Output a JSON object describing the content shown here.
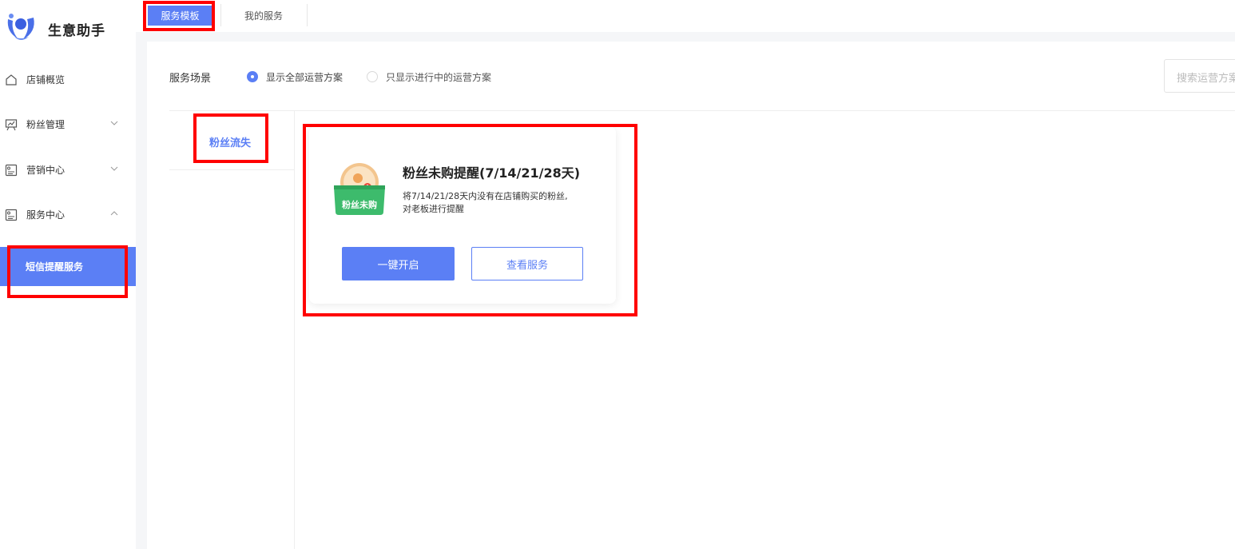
{
  "app": {
    "title": "生意助手"
  },
  "sidebar": {
    "items": [
      {
        "label": "店铺概览",
        "icon": "home-icon"
      },
      {
        "label": "粉丝管理",
        "icon": "chart-board-icon"
      },
      {
        "label": "营销中心",
        "icon": "panel-icon"
      },
      {
        "label": "服务中心",
        "icon": "panel-icon"
      }
    ],
    "active_item": "短信提醒服务"
  },
  "tabs": [
    {
      "label": "服务模板",
      "active": true
    },
    {
      "label": "我的服务",
      "active": false
    }
  ],
  "filter": {
    "scene_label": "服务场景",
    "options": [
      {
        "label": "显示全部运营方案",
        "selected": true
      },
      {
        "label": "只显示进行中的运营方案",
        "selected": false
      }
    ],
    "search_placeholder": "搜索运营方案"
  },
  "category": {
    "label": "粉丝流失"
  },
  "card": {
    "icon_text": "粉丝未购",
    "title": "粉丝未购提醒(7/14/21/28天)",
    "desc_line1": "将7/14/21/28天内没有在店铺购买的粉丝,",
    "desc_line2": "对老板进行提醒",
    "primary_button": "一键开启",
    "secondary_button": "查看服务"
  },
  "colors": {
    "accent": "#5b7ff5",
    "annotation": "#ff0000",
    "icon_orange": "#f0a45a",
    "icon_green": "#3dbb6c"
  }
}
